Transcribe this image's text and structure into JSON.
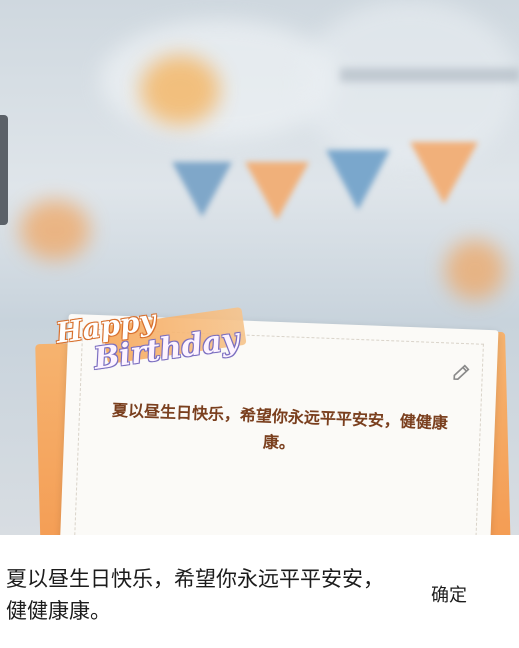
{
  "card": {
    "title_line1": "Happy",
    "title_line2": "Birthday",
    "message": "夏以昼生日快乐，希望你永远平平安安，健健康康。"
  },
  "input": {
    "value": "夏以昼生日快乐，希望你永远平平安安，健健康康。"
  },
  "actions": {
    "confirm_label": "确定"
  },
  "icons": {
    "edit": "edit-icon"
  },
  "colors": {
    "card_text": "#7a3f1e",
    "card_back": "#f49b52"
  }
}
